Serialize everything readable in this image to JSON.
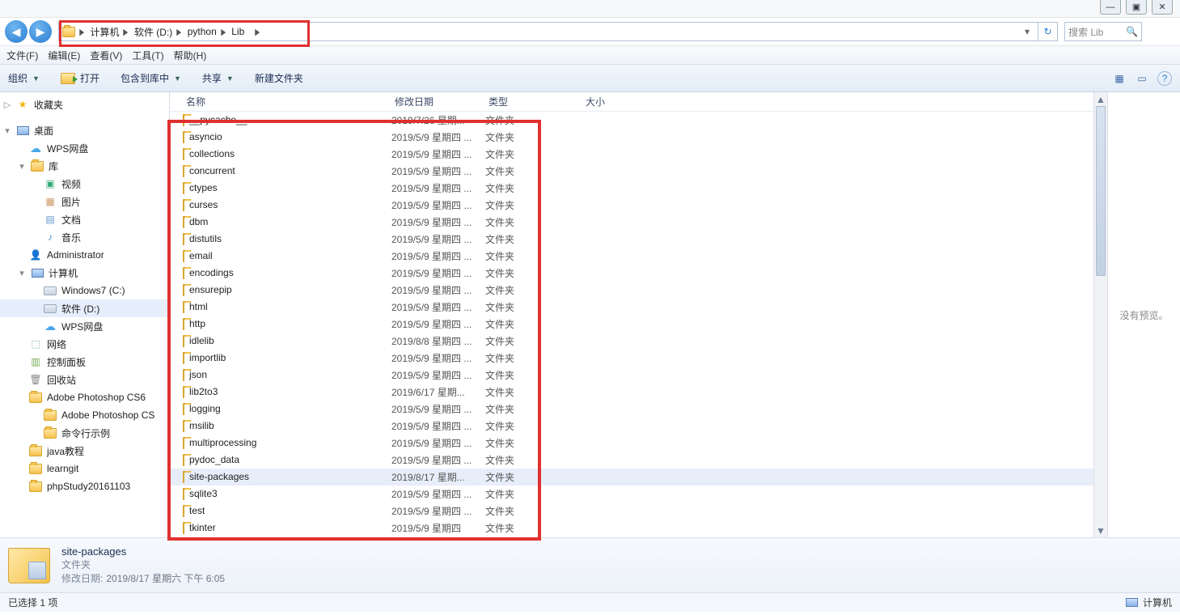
{
  "windowControls": {
    "min": "—",
    "max": "▣",
    "close": "✕"
  },
  "nav": {
    "back": "◀",
    "forward": "▶"
  },
  "breadcrumb": {
    "segments": [
      "计算机",
      "软件 (D:)",
      "python",
      "Lib"
    ]
  },
  "addressRefresh": "↻",
  "search": {
    "placeholder": "搜索 Lib",
    "icon": "🔍"
  },
  "menubar": [
    "文件(F)",
    "编辑(E)",
    "查看(V)",
    "工具(T)",
    "帮助(H)"
  ],
  "toolbar": {
    "organize": "组织",
    "open": "打开",
    "include": "包含到库中",
    "share": "共享",
    "newfolder": "新建文件夹",
    "viewIcon": "▦",
    "previewIcon": "▭",
    "helpIcon": "?"
  },
  "sidebar": [
    {
      "depth": 0,
      "icon": "star",
      "label": "收藏夹",
      "exp": "▷"
    },
    {
      "gap": true
    },
    {
      "depth": 0,
      "icon": "monitor",
      "label": "桌面",
      "exp": "▾"
    },
    {
      "depth": 1,
      "icon": "cloud",
      "label": "WPS网盘"
    },
    {
      "depth": 1,
      "icon": "folder",
      "label": "库",
      "exp": "▾"
    },
    {
      "depth": 2,
      "icon": "video",
      "label": "视频"
    },
    {
      "depth": 2,
      "icon": "image",
      "label": "图片"
    },
    {
      "depth": 2,
      "icon": "doc",
      "label": "文档"
    },
    {
      "depth": 2,
      "icon": "music",
      "label": "音乐"
    },
    {
      "depth": 1,
      "icon": "user",
      "label": "Administrator"
    },
    {
      "depth": 1,
      "icon": "computer",
      "label": "计算机",
      "exp": "▾"
    },
    {
      "depth": 2,
      "icon": "disk",
      "label": "Windows7 (C:)"
    },
    {
      "depth": 2,
      "icon": "disk",
      "label": "软件 (D:)",
      "sel": true
    },
    {
      "depth": 2,
      "icon": "cloud",
      "label": "WPS网盘"
    },
    {
      "depth": 1,
      "icon": "net",
      "label": "网络"
    },
    {
      "depth": 1,
      "icon": "panel",
      "label": "控制面板"
    },
    {
      "depth": 1,
      "icon": "trash",
      "label": "回收站"
    },
    {
      "depth": 1,
      "icon": "folder",
      "label": "Adobe Photoshop CS6"
    },
    {
      "depth": 2,
      "icon": "folder",
      "label": "Adobe Photoshop CS"
    },
    {
      "depth": 2,
      "icon": "folder",
      "label": "命令行示例"
    },
    {
      "depth": 1,
      "icon": "folder",
      "label": "java教程"
    },
    {
      "depth": 1,
      "icon": "folder",
      "label": "learngit"
    },
    {
      "depth": 1,
      "icon": "folder",
      "label": "phpStudy20161103"
    }
  ],
  "columns": {
    "name": "名称",
    "date": "修改日期",
    "type": "类型",
    "size": "大小"
  },
  "rows": [
    {
      "name": "__pycache__",
      "date": "2019/7/26 星期...",
      "type": "文件夹"
    },
    {
      "name": "asyncio",
      "date": "2019/5/9 星期四 ...",
      "type": "文件夹"
    },
    {
      "name": "collections",
      "date": "2019/5/9 星期四 ...",
      "type": "文件夹"
    },
    {
      "name": "concurrent",
      "date": "2019/5/9 星期四 ...",
      "type": "文件夹"
    },
    {
      "name": "ctypes",
      "date": "2019/5/9 星期四 ...",
      "type": "文件夹"
    },
    {
      "name": "curses",
      "date": "2019/5/9 星期四 ...",
      "type": "文件夹"
    },
    {
      "name": "dbm",
      "date": "2019/5/9 星期四 ...",
      "type": "文件夹"
    },
    {
      "name": "distutils",
      "date": "2019/5/9 星期四 ...",
      "type": "文件夹"
    },
    {
      "name": "email",
      "date": "2019/5/9 星期四 ...",
      "type": "文件夹"
    },
    {
      "name": "encodings",
      "date": "2019/5/9 星期四 ...",
      "type": "文件夹"
    },
    {
      "name": "ensurepip",
      "date": "2019/5/9 星期四 ...",
      "type": "文件夹"
    },
    {
      "name": "html",
      "date": "2019/5/9 星期四 ...",
      "type": "文件夹"
    },
    {
      "name": "http",
      "date": "2019/5/9 星期四 ...",
      "type": "文件夹"
    },
    {
      "name": "idlelib",
      "date": "2019/8/8 星期四 ...",
      "type": "文件夹"
    },
    {
      "name": "importlib",
      "date": "2019/5/9 星期四 ...",
      "type": "文件夹"
    },
    {
      "name": "json",
      "date": "2019/5/9 星期四 ...",
      "type": "文件夹"
    },
    {
      "name": "lib2to3",
      "date": "2019/6/17 星期...",
      "type": "文件夹"
    },
    {
      "name": "logging",
      "date": "2019/5/9 星期四 ...",
      "type": "文件夹"
    },
    {
      "name": "msilib",
      "date": "2019/5/9 星期四 ...",
      "type": "文件夹"
    },
    {
      "name": "multiprocessing",
      "date": "2019/5/9 星期四 ...",
      "type": "文件夹"
    },
    {
      "name": "pydoc_data",
      "date": "2019/5/9 星期四 ...",
      "type": "文件夹"
    },
    {
      "name": "site-packages",
      "date": "2019/8/17 星期...",
      "type": "文件夹",
      "sel": true
    },
    {
      "name": "sqlite3",
      "date": "2019/5/9 星期四 ...",
      "type": "文件夹"
    },
    {
      "name": "test",
      "date": "2019/5/9 星期四 ...",
      "type": "文件夹"
    },
    {
      "name": "tkinter",
      "date": "2019/5/9 星期四",
      "type": "文件夹"
    }
  ],
  "preview": "没有预览。",
  "details": {
    "name": "site-packages",
    "type": "文件夹",
    "dateLabel": "修改日期:",
    "dateValue": "2019/8/17 星期六 下午 6:05"
  },
  "status": {
    "left": "已选择 1 项",
    "rightLabel": "计算机"
  }
}
